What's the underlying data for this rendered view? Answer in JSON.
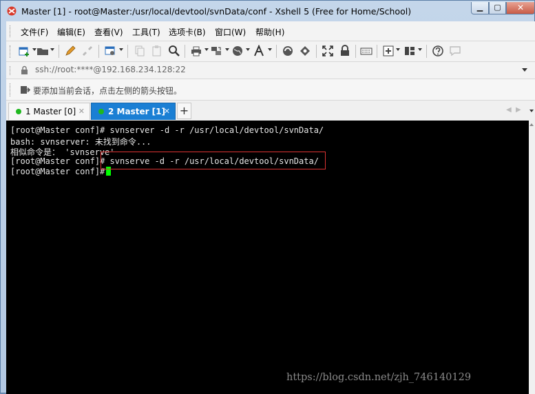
{
  "window": {
    "title": "Master [1] - root@Master:/usr/local/devtool/svnData/conf - Xshell 5 (Free for Home/School)",
    "controls": {
      "minimize": "▁",
      "maximize": "▢",
      "close": "✕"
    }
  },
  "menu": {
    "items": [
      "文件(F)",
      "编辑(E)",
      "查看(V)",
      "工具(T)",
      "选项卡(B)",
      "窗口(W)",
      "帮助(H)"
    ]
  },
  "toolbar": {
    "icons": [
      "new-session-icon",
      "open-folder-icon",
      "pencil-icon",
      "disconnect-icon",
      "properties-icon",
      "copy-icon",
      "paste-icon",
      "find-icon",
      "print-icon",
      "transfer-icon",
      "globe-icon",
      "font-icon",
      "xftp-icon",
      "xmanager-icon",
      "fullscreen-icon",
      "lock-icon",
      "keyboard-icon",
      "add-icon",
      "layout-icon",
      "help-icon",
      "chat-icon"
    ]
  },
  "address": {
    "value": "ssh://root:****@192.168.234.128:22"
  },
  "hint": {
    "text": "要添加当前会话，点击左侧的箭头按钮。"
  },
  "tabs": [
    {
      "label": "1 Master [0]",
      "active": false,
      "status_color": "#1fb81f"
    },
    {
      "label": "2 Master [1]",
      "active": true,
      "status_color": "#1fb81f"
    }
  ],
  "tab_add_label": "+",
  "tab_close_label": "✕",
  "tab_nav": {
    "prev": "◀",
    "next": "▶"
  },
  "terminal": {
    "lines": [
      "[root@Master conf]# svnserver -d -r /usr/local/devtool/svnData/",
      "bash: svnserver: 未找到命令...",
      "相似命令是： 'svnserve'",
      "[root@Master conf]# svnserve -d -r /usr/local/devtool/svnData/",
      "[root@Master conf]# "
    ],
    "cursor_color": "#00ff00",
    "highlight_color": "#dd3333"
  },
  "watermark": "https://blog.csdn.net/zjh_746140129"
}
